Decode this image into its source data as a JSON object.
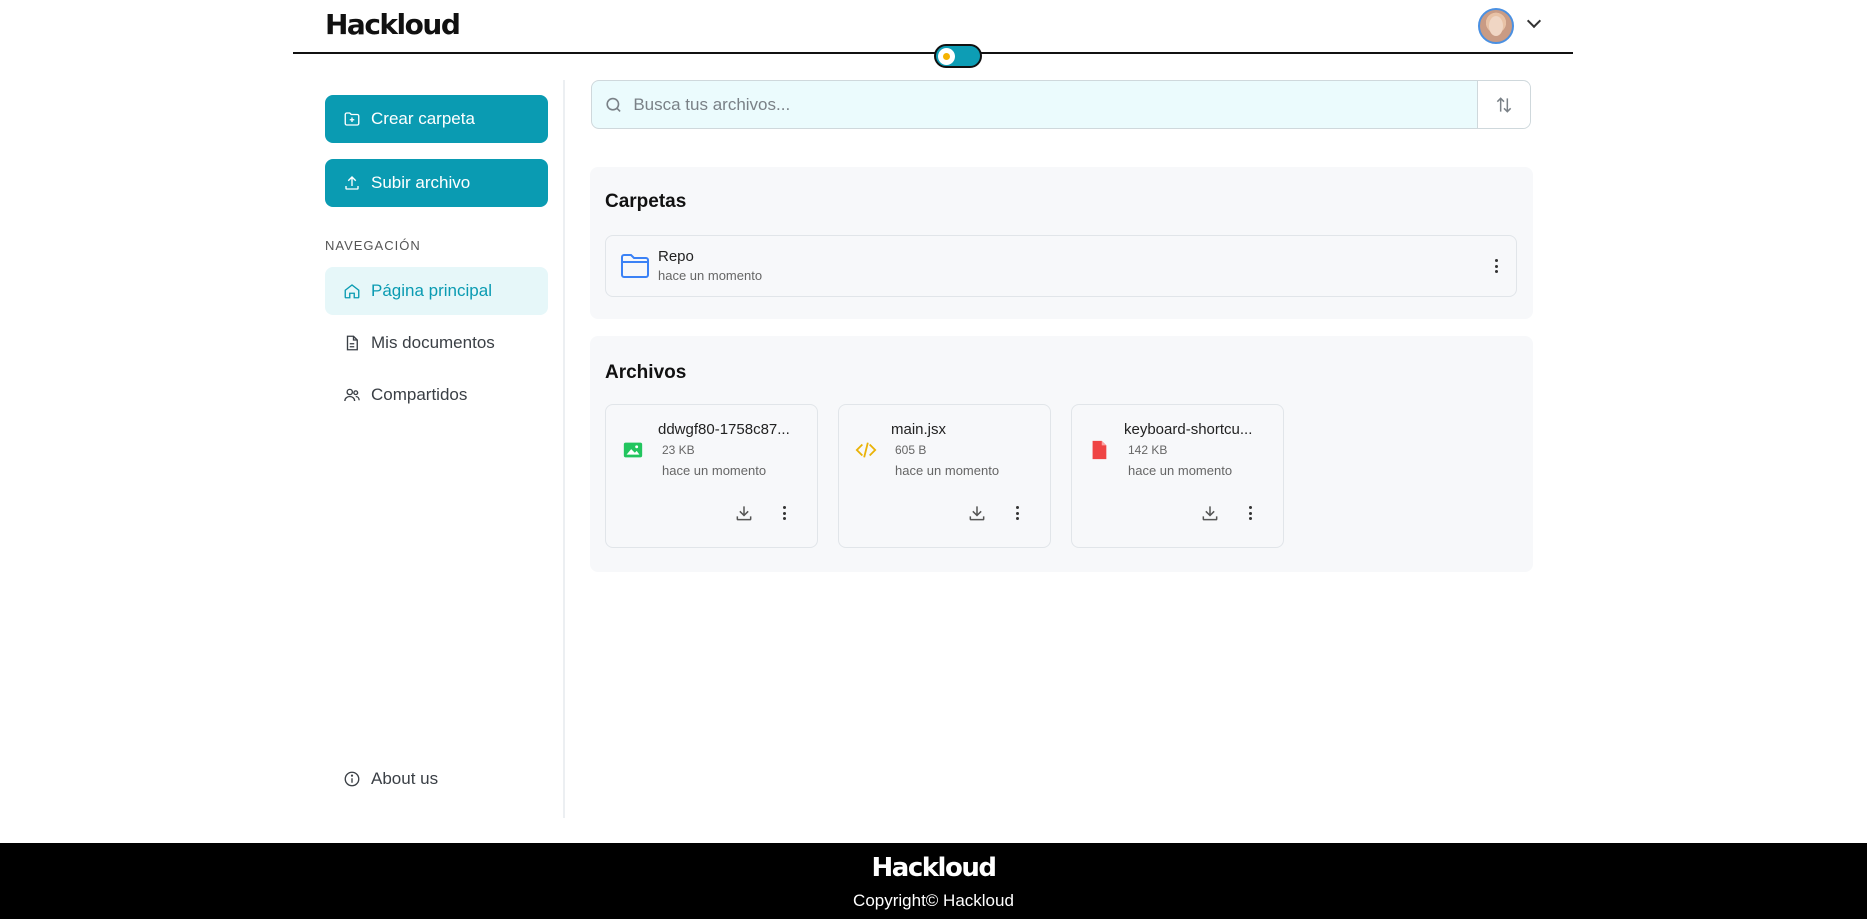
{
  "header": {
    "logo": "Hackloud",
    "theme_toggle": "light"
  },
  "sidebar": {
    "create_folder": "Crear carpeta",
    "upload_file": "Subir archivo",
    "nav_title": "NAVEGACIÓN",
    "items": [
      {
        "label": "Página principal",
        "active": true
      },
      {
        "label": "Mis documentos",
        "active": false
      },
      {
        "label": "Compartidos",
        "active": false
      }
    ],
    "about": "About us"
  },
  "search": {
    "placeholder": "Busca tus archivos..."
  },
  "folders": {
    "title": "Carpetas",
    "items": [
      {
        "name": "Repo",
        "date": "hace un momento"
      }
    ]
  },
  "files": {
    "title": "Archivos",
    "items": [
      {
        "name": "ddwgf80-1758c87...",
        "size": "23 KB",
        "date": "hace un momento",
        "icon": "image-icon"
      },
      {
        "name": "main.jsx",
        "size": "605 B",
        "date": "hace un momento",
        "icon": "code-icon"
      },
      {
        "name": "keyboard-shortcu...",
        "size": "142 KB",
        "date": "hace un momento",
        "icon": "pdf-file-icon"
      }
    ]
  },
  "footer": {
    "logo": "Hackloud",
    "copyright": "Copyright© Hackloud"
  },
  "colors": {
    "accent": "#0a9bb2",
    "search_bg": "#ebfbfd",
    "panel_bg": "#f7f8fa",
    "footer_bg": "#000000"
  }
}
